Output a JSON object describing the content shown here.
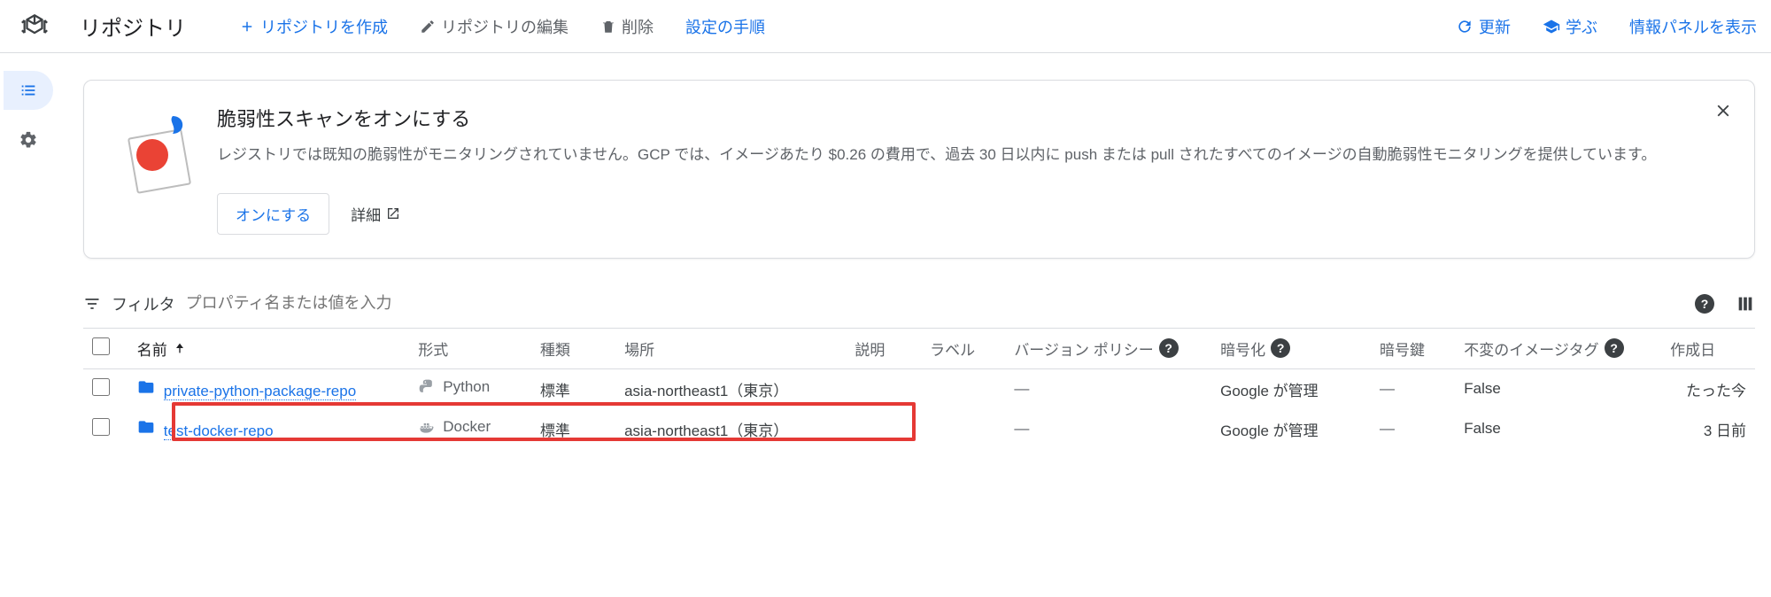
{
  "header": {
    "page_title": "リポジトリ",
    "create": "リポジトリを作成",
    "edit": "リポジトリの編集",
    "delete": "削除",
    "setup": "設定の手順",
    "refresh": "更新",
    "learn": "学ぶ",
    "info_panel": "情報パネルを表示"
  },
  "banner": {
    "title": "脆弱性スキャンをオンにする",
    "desc": "レジストリでは既知の脆弱性がモニタリングされていません。GCP では、イメージあたり $0.26 の費用で、過去 30 日以内に push または pull されたすべてのイメージの自動脆弱性モニタリングを提供しています。",
    "turn_on": "オンにする",
    "details": "詳細"
  },
  "filter": {
    "label": "フィルタ",
    "placeholder": "プロパティ名または値を入力"
  },
  "columns": {
    "name": "名前",
    "format": "形式",
    "kind": "種類",
    "location": "場所",
    "desc": "説明",
    "label": "ラベル",
    "policy": "バージョン ポリシー",
    "encryption": "暗号化",
    "key": "暗号鍵",
    "immutable": "不変のイメージタグ",
    "created": "作成日"
  },
  "rows": [
    {
      "name": "private-python-package-repo",
      "format": "Python",
      "kind": "標準",
      "location": "asia-northeast1（東京）",
      "policy": "—",
      "encryption": "Google が管理",
      "key": "—",
      "immutable": "False",
      "created": "たった今"
    },
    {
      "name": "test-docker-repo",
      "format": "Docker",
      "kind": "標準",
      "location": "asia-northeast1（東京）",
      "policy": "—",
      "encryption": "Google が管理",
      "key": "—",
      "immutable": "False",
      "created": "3 日前"
    }
  ]
}
